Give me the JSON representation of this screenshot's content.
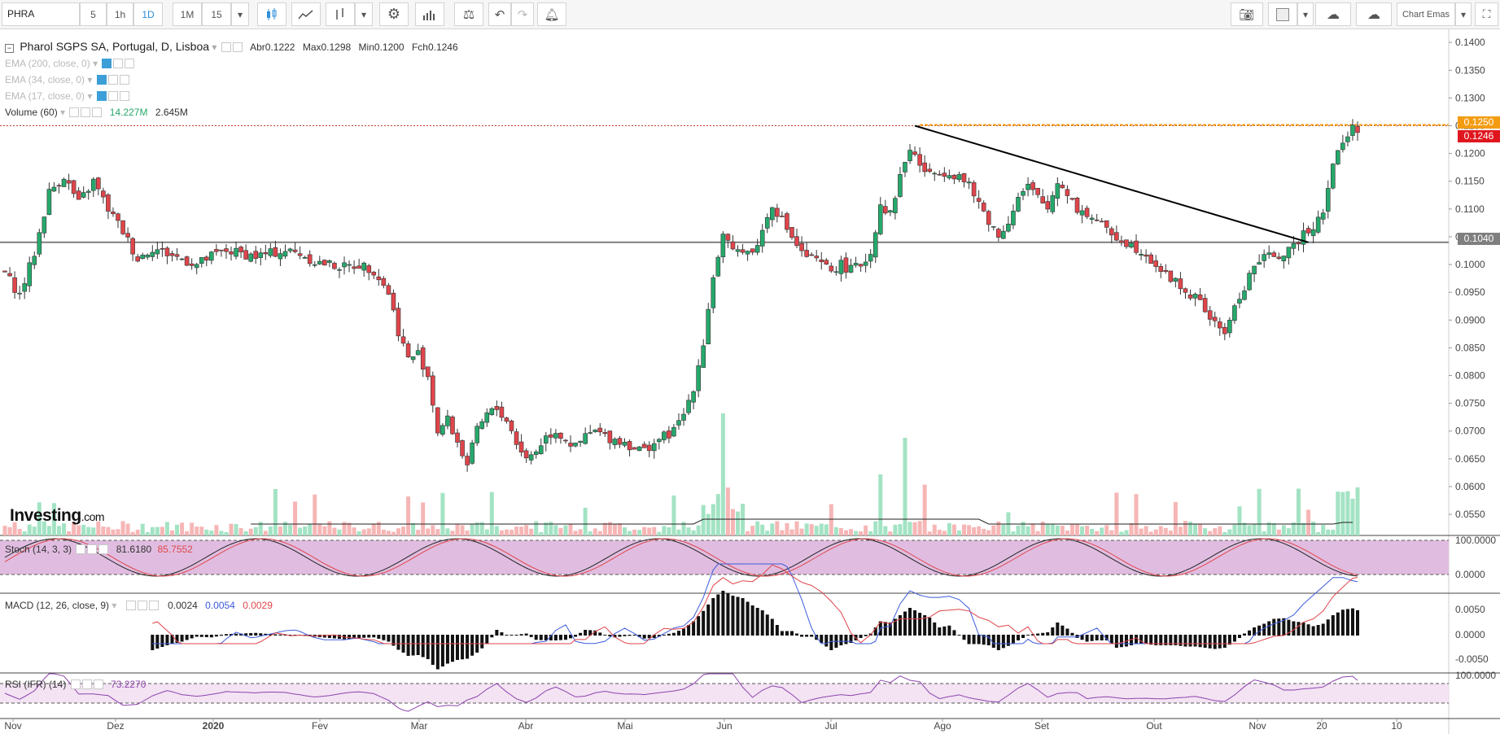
{
  "toolbar": {
    "symbol": "PHRA",
    "intervals": [
      "5",
      "1h",
      "1D",
      "1M",
      "15"
    ],
    "active_interval": "1D",
    "template_label": "Chart Emas"
  },
  "legend": {
    "instrument": "Pharol SGPS SA, Portugal, D, Lisboa",
    "open_label": "Abr",
    "open": "0.1222",
    "high_label": "Max",
    "high": "0.1298",
    "low_label": "Min",
    "low": "0.1200",
    "close_label": "Fch",
    "close": "0.1246",
    "ema200": "EMA (200, close, 0)",
    "ema34": "EMA (34, close, 0)",
    "ema17": "EMA (17, close, 0)",
    "volume": "Volume (60)",
    "volume_v1": "14.227M",
    "volume_v2": "2.645M",
    "stoch": "Stoch (14, 3, 3)",
    "stoch_k": "81.6180",
    "stoch_d": "85.7552",
    "macd": "MACD (12, 26, close, 9)",
    "macd_v1": "0.0024",
    "macd_v2": "0.0054",
    "macd_v3": "0.0029",
    "rsi": "RSI (IFR) (14)",
    "rsi_v": "73.2270"
  },
  "price_tags": {
    "resistance": "0.1250",
    "last": "0.1246",
    "support": "0.1040"
  },
  "watermark": {
    "brand": "Investing",
    "suffix": ".com"
  },
  "colors": {
    "up": "#26a96c",
    "down": "#e0454b",
    "stoch_band": "#e0bde0",
    "rsi_band": "#f3e3f3",
    "macd_line": "#3b5bdb",
    "signal_line": "#e0454b",
    "resistance": "#f39c12",
    "support": "#7f7f7f"
  },
  "chart_data": {
    "type": "candlestick",
    "price_axis": {
      "ticks": [
        "0.1400",
        "0.1350",
        "0.1300",
        "0.1250",
        "0.1200",
        "0.1150",
        "0.1100",
        "0.1050",
        "0.1000",
        "0.0950",
        "0.0900",
        "0.0850",
        "0.0800",
        "0.0750",
        "0.0700",
        "0.0650",
        "0.0600",
        "0.0550"
      ],
      "range": [
        0.0512,
        0.1412
      ]
    },
    "x_axis_labels": [
      "Nov",
      "Dez",
      "2020",
      "Fev",
      "Mar",
      "Abr",
      "Mai",
      "Jun",
      "Jul",
      "Ago",
      "Set",
      "Out",
      "Nov",
      "20",
      "10"
    ],
    "close_path": [
      [
        0,
        0.0985
      ],
      [
        3,
        0.0945
      ],
      [
        6,
        0.102
      ],
      [
        9,
        0.113
      ],
      [
        12,
        0.116
      ],
      [
        15,
        0.111
      ],
      [
        18,
        0.115
      ],
      [
        21,
        0.11
      ],
      [
        24,
        0.106
      ],
      [
        27,
        0.101
      ],
      [
        30,
        0.103
      ],
      [
        33,
        0.102
      ],
      [
        36,
        0.101
      ],
      [
        39,
        0.1
      ],
      [
        42,
        0.1015
      ],
      [
        45,
        0.1025
      ],
      [
        48,
        0.102
      ],
      [
        51,
        0.1015
      ],
      [
        54,
        0.102
      ],
      [
        57,
        0.1025
      ],
      [
        60,
        0.102
      ],
      [
        63,
        0.1005
      ],
      [
        66,
        0.1
      ],
      [
        69,
        0.0995
      ],
      [
        72,
        0.1
      ],
      [
        75,
        0.099
      ],
      [
        78,
        0.095
      ],
      [
        80,
        0.088
      ],
      [
        82,
        0.083
      ],
      [
        84,
        0.084
      ],
      [
        86,
        0.08
      ],
      [
        88,
        0.07
      ],
      [
        90,
        0.072
      ],
      [
        92,
        0.068
      ],
      [
        94,
        0.064
      ],
      [
        96,
        0.07
      ],
      [
        98,
        0.073
      ],
      [
        100,
        0.074
      ],
      [
        102,
        0.072
      ],
      [
        104,
        0.068
      ],
      [
        106,
        0.065
      ],
      [
        108,
        0.0665
      ],
      [
        110,
        0.069
      ],
      [
        112,
        0.07
      ],
      [
        114,
        0.0685
      ],
      [
        116,
        0.067
      ],
      [
        118,
        0.069
      ],
      [
        120,
        0.07
      ],
      [
        122,
        0.069
      ],
      [
        124,
        0.0685
      ],
      [
        126,
        0.068
      ],
      [
        128,
        0.067
      ],
      [
        130,
        0.0665
      ],
      [
        132,
        0.068
      ],
      [
        134,
        0.069
      ],
      [
        136,
        0.07
      ],
      [
        138,
        0.073
      ],
      [
        140,
        0.078
      ],
      [
        142,
        0.086
      ],
      [
        144,
        0.098
      ],
      [
        146,
        0.105
      ],
      [
        148,
        0.102
      ],
      [
        150,
        0.103
      ],
      [
        152,
        0.102
      ],
      [
        154,
        0.106
      ],
      [
        156,
        0.111
      ],
      [
        158,
        0.108
      ],
      [
        160,
        0.105
      ],
      [
        162,
        0.102
      ],
      [
        164,
        0.101
      ],
      [
        166,
        0.1
      ],
      [
        168,
        0.099
      ],
      [
        170,
        0.1
      ],
      [
        172,
        0.099
      ],
      [
        174,
        0.1
      ],
      [
        176,
        0.102
      ],
      [
        178,
        0.111
      ],
      [
        180,
        0.109
      ],
      [
        182,
        0.116
      ],
      [
        184,
        0.121
      ],
      [
        186,
        0.118
      ],
      [
        188,
        0.116
      ],
      [
        190,
        0.117
      ],
      [
        192,
        0.1165
      ],
      [
        194,
        0.116
      ],
      [
        196,
        0.114
      ],
      [
        198,
        0.111
      ],
      [
        200,
        0.108
      ],
      [
        202,
        0.105
      ],
      [
        204,
        0.108
      ],
      [
        206,
        0.112
      ],
      [
        208,
        0.114
      ],
      [
        210,
        0.112
      ],
      [
        212,
        0.11
      ],
      [
        214,
        0.115
      ],
      [
        216,
        0.113
      ],
      [
        218,
        0.11
      ],
      [
        220,
        0.109
      ],
      [
        222,
        0.108
      ],
      [
        224,
        0.106
      ],
      [
        226,
        0.105
      ],
      [
        228,
        0.104
      ],
      [
        230,
        0.103
      ],
      [
        232,
        0.102
      ],
      [
        234,
        0.1
      ],
      [
        236,
        0.098
      ],
      [
        238,
        0.097
      ],
      [
        240,
        0.095
      ],
      [
        242,
        0.094
      ],
      [
        244,
        0.092
      ],
      [
        246,
        0.089
      ],
      [
        248,
        0.088
      ],
      [
        250,
        0.092
      ],
      [
        252,
        0.096
      ],
      [
        254,
        0.1
      ],
      [
        256,
        0.101
      ],
      [
        258,
        0.102
      ],
      [
        260,
        0.1015
      ],
      [
        262,
        0.103
      ],
      [
        264,
        0.106
      ],
      [
        266,
        0.107
      ],
      [
        268,
        0.11
      ],
      [
        270,
        0.118
      ],
      [
        272,
        0.122
      ],
      [
        274,
        0.1246
      ]
    ],
    "trendline": {
      "from": [
        185,
        0.125
      ],
      "to": [
        265,
        0.104
      ]
    },
    "resistance_level": 0.125,
    "support_level": 0.104,
    "stoch_axis": [
      "100.0000",
      "0.0000"
    ],
    "macd_axis": [
      "0.0050",
      "0.0000",
      "-0.0050"
    ],
    "rsi_axis": [
      "100.0000"
    ]
  }
}
